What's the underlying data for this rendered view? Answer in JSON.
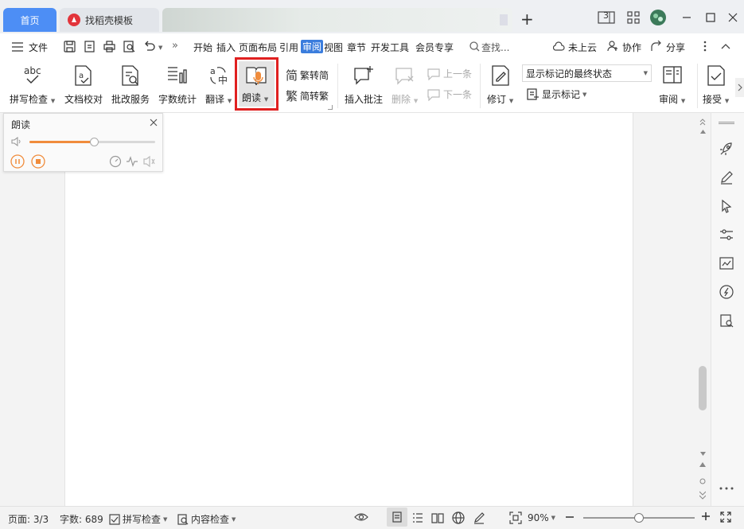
{
  "tabs": {
    "home": "首页",
    "templates": "找稻壳模板"
  },
  "title_controls": {
    "layout_label": "3"
  },
  "menu": {
    "file": "文件",
    "items": [
      "开始",
      "插入",
      "页面布局",
      "引用",
      "审阅",
      "视图",
      "章节",
      "开发工具",
      "会员专享"
    ],
    "search": "查找...",
    "cloud": "未上云",
    "collab": "协作",
    "share": "分享"
  },
  "ribbon": {
    "spell_check": "拼写检查",
    "proofread": "文档校对",
    "correction_service": "批改服务",
    "word_count": "字数统计",
    "translate": "翻译",
    "read_aloud": "朗读",
    "trad_to_simp": "繁转简",
    "simp_to_trad": "简转繁",
    "insert_comment": "插入批注",
    "delete": "删除",
    "prev": "上一条",
    "next": "下一条",
    "revise": "修订",
    "markup_state": "显示标记的最终状态",
    "show_markup": "显示标记",
    "review": "审阅",
    "accept": "接受",
    "spell_abc": "abc"
  },
  "read_panel": {
    "title": "朗读",
    "volume_percent": 52
  },
  "status": {
    "page": "页面: 3/3",
    "words": "字数: 689",
    "spell": "拼写检查",
    "content_check": "内容检查",
    "zoom": "90%",
    "zoom_slider_percent": 50
  },
  "colors": {
    "accent": "#4d8ef5",
    "highlight_box": "#e02020",
    "slider": "#f08c3c"
  }
}
